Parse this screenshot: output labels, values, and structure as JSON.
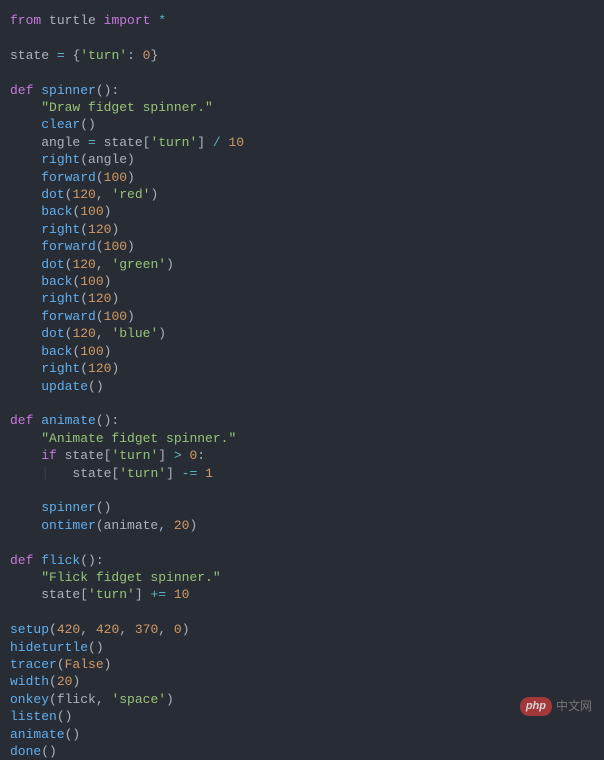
{
  "watermark": {
    "badge": "php",
    "text": "中文网"
  },
  "code": {
    "lines": [
      [
        {
          "c": "tk-kw",
          "t": "from"
        },
        {
          "c": "tk-plain",
          "t": " turtle "
        },
        {
          "c": "tk-kw",
          "t": "import"
        },
        {
          "c": "tk-plain",
          "t": " "
        },
        {
          "c": "tk-op",
          "t": "*"
        }
      ],
      "",
      [
        {
          "c": "tk-plain",
          "t": "state "
        },
        {
          "c": "tk-op",
          "t": "="
        },
        {
          "c": "tk-plain",
          "t": " "
        },
        {
          "c": "tk-punct",
          "t": "{"
        },
        {
          "c": "tk-str",
          "t": "'turn'"
        },
        {
          "c": "tk-punct",
          "t": ": "
        },
        {
          "c": "tk-num",
          "t": "0"
        },
        {
          "c": "tk-punct",
          "t": "}"
        }
      ],
      "",
      [
        {
          "c": "tk-kw",
          "t": "def"
        },
        {
          "c": "tk-plain",
          "t": " "
        },
        {
          "c": "tk-fn",
          "t": "spinner"
        },
        {
          "c": "tk-punct",
          "t": "():"
        }
      ],
      [
        {
          "c": "tk-plain",
          "t": "    "
        },
        {
          "c": "tk-str",
          "t": "\"Draw fidget spinner.\""
        }
      ],
      [
        {
          "c": "tk-plain",
          "t": "    "
        },
        {
          "c": "tk-call",
          "t": "clear"
        },
        {
          "c": "tk-punct",
          "t": "()"
        }
      ],
      [
        {
          "c": "tk-plain",
          "t": "    angle "
        },
        {
          "c": "tk-op",
          "t": "="
        },
        {
          "c": "tk-plain",
          "t": " state["
        },
        {
          "c": "tk-str",
          "t": "'turn'"
        },
        {
          "c": "tk-plain",
          "t": "] "
        },
        {
          "c": "tk-op",
          "t": "/"
        },
        {
          "c": "tk-plain",
          "t": " "
        },
        {
          "c": "tk-num",
          "t": "10"
        }
      ],
      [
        {
          "c": "tk-plain",
          "t": "    "
        },
        {
          "c": "tk-call",
          "t": "right"
        },
        {
          "c": "tk-punct",
          "t": "(angle)"
        }
      ],
      [
        {
          "c": "tk-plain",
          "t": "    "
        },
        {
          "c": "tk-call",
          "t": "forward"
        },
        {
          "c": "tk-punct",
          "t": "("
        },
        {
          "c": "tk-num",
          "t": "100"
        },
        {
          "c": "tk-punct",
          "t": ")"
        }
      ],
      [
        {
          "c": "tk-plain",
          "t": "    "
        },
        {
          "c": "tk-call",
          "t": "dot"
        },
        {
          "c": "tk-punct",
          "t": "("
        },
        {
          "c": "tk-num",
          "t": "120"
        },
        {
          "c": "tk-punct",
          "t": ", "
        },
        {
          "c": "tk-str",
          "t": "'red'"
        },
        {
          "c": "tk-punct",
          "t": ")"
        }
      ],
      [
        {
          "c": "tk-plain",
          "t": "    "
        },
        {
          "c": "tk-call",
          "t": "back"
        },
        {
          "c": "tk-punct",
          "t": "("
        },
        {
          "c": "tk-num",
          "t": "100"
        },
        {
          "c": "tk-punct",
          "t": ")"
        }
      ],
      [
        {
          "c": "tk-plain",
          "t": "    "
        },
        {
          "c": "tk-call",
          "t": "right"
        },
        {
          "c": "tk-punct",
          "t": "("
        },
        {
          "c": "tk-num",
          "t": "120"
        },
        {
          "c": "tk-punct",
          "t": ")"
        }
      ],
      [
        {
          "c": "tk-plain",
          "t": "    "
        },
        {
          "c": "tk-call",
          "t": "forward"
        },
        {
          "c": "tk-punct",
          "t": "("
        },
        {
          "c": "tk-num",
          "t": "100"
        },
        {
          "c": "tk-punct",
          "t": ")"
        }
      ],
      [
        {
          "c": "tk-plain",
          "t": "    "
        },
        {
          "c": "tk-call",
          "t": "dot"
        },
        {
          "c": "tk-punct",
          "t": "("
        },
        {
          "c": "tk-num",
          "t": "120"
        },
        {
          "c": "tk-punct",
          "t": ", "
        },
        {
          "c": "tk-str",
          "t": "'green'"
        },
        {
          "c": "tk-punct",
          "t": ")"
        }
      ],
      [
        {
          "c": "tk-plain",
          "t": "    "
        },
        {
          "c": "tk-call",
          "t": "back"
        },
        {
          "c": "tk-punct",
          "t": "("
        },
        {
          "c": "tk-num",
          "t": "100"
        },
        {
          "c": "tk-punct",
          "t": ")"
        }
      ],
      [
        {
          "c": "tk-plain",
          "t": "    "
        },
        {
          "c": "tk-call",
          "t": "right"
        },
        {
          "c": "tk-punct",
          "t": "("
        },
        {
          "c": "tk-num",
          "t": "120"
        },
        {
          "c": "tk-punct",
          "t": ")"
        }
      ],
      [
        {
          "c": "tk-plain",
          "t": "    "
        },
        {
          "c": "tk-call",
          "t": "forward"
        },
        {
          "c": "tk-punct",
          "t": "("
        },
        {
          "c": "tk-num",
          "t": "100"
        },
        {
          "c": "tk-punct",
          "t": ")"
        }
      ],
      [
        {
          "c": "tk-plain",
          "t": "    "
        },
        {
          "c": "tk-call",
          "t": "dot"
        },
        {
          "c": "tk-punct",
          "t": "("
        },
        {
          "c": "tk-num",
          "t": "120"
        },
        {
          "c": "tk-punct",
          "t": ", "
        },
        {
          "c": "tk-str",
          "t": "'blue'"
        },
        {
          "c": "tk-punct",
          "t": ")"
        }
      ],
      [
        {
          "c": "tk-plain",
          "t": "    "
        },
        {
          "c": "tk-call",
          "t": "back"
        },
        {
          "c": "tk-punct",
          "t": "("
        },
        {
          "c": "tk-num",
          "t": "100"
        },
        {
          "c": "tk-punct",
          "t": ")"
        }
      ],
      [
        {
          "c": "tk-plain",
          "t": "    "
        },
        {
          "c": "tk-call",
          "t": "right"
        },
        {
          "c": "tk-punct",
          "t": "("
        },
        {
          "c": "tk-num",
          "t": "120"
        },
        {
          "c": "tk-punct",
          "t": ")"
        }
      ],
      [
        {
          "c": "tk-plain",
          "t": "    "
        },
        {
          "c": "tk-call",
          "t": "update"
        },
        {
          "c": "tk-punct",
          "t": "()"
        }
      ],
      "",
      [
        {
          "c": "tk-kw",
          "t": "def"
        },
        {
          "c": "tk-plain",
          "t": " "
        },
        {
          "c": "tk-fn",
          "t": "animate"
        },
        {
          "c": "tk-punct",
          "t": "():"
        }
      ],
      [
        {
          "c": "tk-plain",
          "t": "    "
        },
        {
          "c": "tk-str",
          "t": "\"Animate fidget spinner.\""
        }
      ],
      [
        {
          "c": "tk-plain",
          "t": "    "
        },
        {
          "c": "tk-kw",
          "t": "if"
        },
        {
          "c": "tk-plain",
          "t": " state["
        },
        {
          "c": "tk-str",
          "t": "'turn'"
        },
        {
          "c": "tk-plain",
          "t": "] "
        },
        {
          "c": "tk-op",
          "t": ">"
        },
        {
          "c": "tk-plain",
          "t": " "
        },
        {
          "c": "tk-num",
          "t": "0"
        },
        {
          "c": "tk-punct",
          "t": ":"
        }
      ],
      [
        {
          "c": "tk-plain",
          "t": "    "
        },
        {
          "c": "indent-guide",
          "t": "│"
        },
        {
          "c": "tk-plain",
          "t": "   state["
        },
        {
          "c": "tk-str",
          "t": "'turn'"
        },
        {
          "c": "tk-plain",
          "t": "] "
        },
        {
          "c": "tk-op",
          "t": "-="
        },
        {
          "c": "tk-plain",
          "t": " "
        },
        {
          "c": "tk-num",
          "t": "1"
        }
      ],
      "",
      [
        {
          "c": "tk-plain",
          "t": "    "
        },
        {
          "c": "tk-call",
          "t": "spinner"
        },
        {
          "c": "tk-punct",
          "t": "()"
        }
      ],
      [
        {
          "c": "tk-plain",
          "t": "    "
        },
        {
          "c": "tk-call",
          "t": "ontimer"
        },
        {
          "c": "tk-punct",
          "t": "(animate, "
        },
        {
          "c": "tk-num",
          "t": "20"
        },
        {
          "c": "tk-punct",
          "t": ")"
        }
      ],
      "",
      [
        {
          "c": "tk-kw",
          "t": "def"
        },
        {
          "c": "tk-plain",
          "t": " "
        },
        {
          "c": "tk-fn",
          "t": "flick"
        },
        {
          "c": "tk-punct",
          "t": "():"
        }
      ],
      [
        {
          "c": "tk-plain",
          "t": "    "
        },
        {
          "c": "tk-str",
          "t": "\"Flick fidget spinner.\""
        }
      ],
      [
        {
          "c": "tk-plain",
          "t": "    state["
        },
        {
          "c": "tk-str",
          "t": "'turn'"
        },
        {
          "c": "tk-plain",
          "t": "] "
        },
        {
          "c": "tk-op",
          "t": "+="
        },
        {
          "c": "tk-plain",
          "t": " "
        },
        {
          "c": "tk-num",
          "t": "10"
        }
      ],
      "",
      [
        {
          "c": "tk-call",
          "t": "setup"
        },
        {
          "c": "tk-punct",
          "t": "("
        },
        {
          "c": "tk-num",
          "t": "420"
        },
        {
          "c": "tk-punct",
          "t": ", "
        },
        {
          "c": "tk-num",
          "t": "420"
        },
        {
          "c": "tk-punct",
          "t": ", "
        },
        {
          "c": "tk-num",
          "t": "370"
        },
        {
          "c": "tk-punct",
          "t": ", "
        },
        {
          "c": "tk-num",
          "t": "0"
        },
        {
          "c": "tk-punct",
          "t": ")"
        }
      ],
      [
        {
          "c": "tk-call",
          "t": "hideturtle"
        },
        {
          "c": "tk-punct",
          "t": "()"
        }
      ],
      [
        {
          "c": "tk-call",
          "t": "tracer"
        },
        {
          "c": "tk-punct",
          "t": "("
        },
        {
          "c": "tk-const",
          "t": "False"
        },
        {
          "c": "tk-punct",
          "t": ")"
        }
      ],
      [
        {
          "c": "tk-call",
          "t": "width"
        },
        {
          "c": "tk-punct",
          "t": "("
        },
        {
          "c": "tk-num",
          "t": "20"
        },
        {
          "c": "tk-punct",
          "t": ")"
        }
      ],
      [
        {
          "c": "tk-call",
          "t": "onkey"
        },
        {
          "c": "tk-punct",
          "t": "(flick, "
        },
        {
          "c": "tk-str",
          "t": "'space'"
        },
        {
          "c": "tk-punct",
          "t": ")"
        }
      ],
      [
        {
          "c": "tk-call",
          "t": "listen"
        },
        {
          "c": "tk-punct",
          "t": "()"
        }
      ],
      [
        {
          "c": "tk-call",
          "t": "animate"
        },
        {
          "c": "tk-punct",
          "t": "()"
        }
      ],
      [
        {
          "c": "tk-call",
          "t": "done"
        },
        {
          "c": "tk-punct",
          "t": "()"
        }
      ]
    ]
  }
}
